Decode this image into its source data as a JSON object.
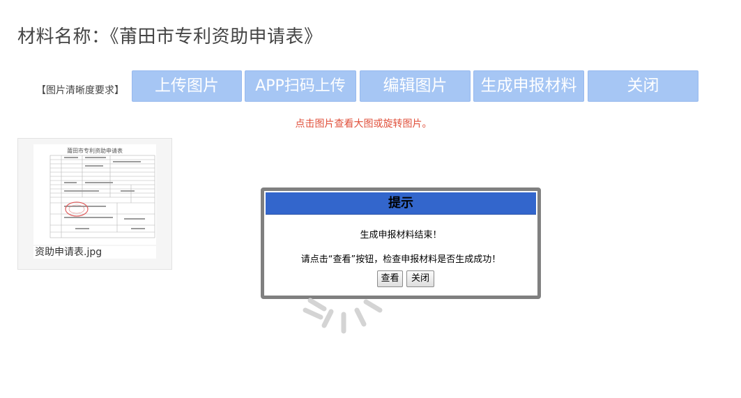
{
  "page": {
    "title": "材料名称：《莆田市专利资助申请表》"
  },
  "toolbar": {
    "requirement_link": "【图片清晰度要求】",
    "buttons": [
      "上传图片",
      "APP扫码上传",
      "编辑图片",
      "生成申报材料",
      "关闭"
    ]
  },
  "hint": "点击图片查看大图或旋转图片。",
  "thumbnail": {
    "caption": "资助申请表.jpg",
    "doc_heading": "莆田市专利资助申请表"
  },
  "dialog": {
    "title": "提示",
    "message1": "生成申报材料结束！",
    "message2": "请点击“查看”按钮，检查申报材料是否生成成功！",
    "view_label": "查看",
    "close_label": "关闭",
    "header_color": "#3366cc"
  },
  "colors": {
    "button_bg": "#a6c6f4",
    "hint_text": "#e0503b"
  }
}
